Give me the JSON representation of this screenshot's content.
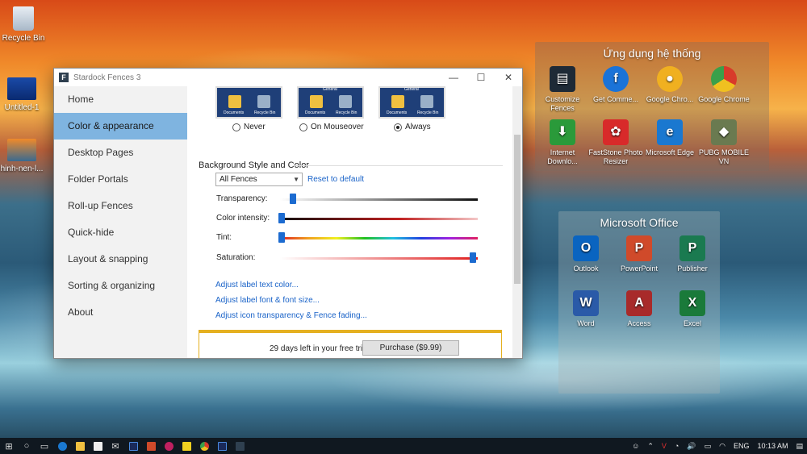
{
  "desktop": {
    "icons": [
      {
        "label": "Recycle Bin"
      },
      {
        "label": "Untitled-1"
      },
      {
        "label": "hinh-nen-l..."
      }
    ]
  },
  "window": {
    "title": "Stardock Fences 3",
    "controls": {
      "minimize": "—",
      "maximize": "☐",
      "close": "✕"
    },
    "sidebar": [
      {
        "label": "Home"
      },
      {
        "label": "Color & appearance",
        "active": true
      },
      {
        "label": "Desktop Pages"
      },
      {
        "label": "Folder Portals"
      },
      {
        "label": "Roll-up Fences"
      },
      {
        "label": "Quick-hide"
      },
      {
        "label": "Layout & snapping"
      },
      {
        "label": "Sorting & organizing"
      },
      {
        "label": "About"
      }
    ],
    "preview_options": [
      {
        "label": "Never",
        "selected": false
      },
      {
        "label": "On Mouseover",
        "selected": false
      },
      {
        "label": "Always",
        "selected": true
      }
    ],
    "preview_captions": {
      "general": "General",
      "documents": "Documents",
      "recycle": "Recycle Bin"
    },
    "background_section": {
      "title": "Background Style and Color",
      "dropdown_value": "All Fences",
      "reset_link": "Reset to default",
      "sliders": [
        {
          "label": "Transparency:",
          "value": 0.06
        },
        {
          "label": "Color intensity:",
          "value": 0.0
        },
        {
          "label": "Tint:",
          "value": 0.0
        },
        {
          "label": "Saturation:",
          "value": 1.0
        }
      ]
    },
    "links": [
      "Adjust label text color...",
      "Adjust label font & font size...",
      "Adjust icon transparency & Fence fading..."
    ],
    "trial": {
      "text": "29 days left in your free trial",
      "button": "Purchase ($9.99)"
    }
  },
  "fence_system": {
    "title": "Ứng dụng hệ thống",
    "items": [
      {
        "label": "Customize Fences",
        "icon": "fences-icon",
        "color": "#1e2a36"
      },
      {
        "label": "Get Comme...",
        "icon": "skype-icon",
        "color": "#1a73d8"
      },
      {
        "label": "Google Chro...",
        "icon": "chrome-canary-icon",
        "color": "#f0b020"
      },
      {
        "label": "Google Chrome",
        "icon": "chrome-icon",
        "color": "#3aa04a"
      },
      {
        "label": "Internet Downlo...",
        "icon": "download-icon",
        "color": "#2a9a3a"
      },
      {
        "label": "FastStone Photo Resizer",
        "icon": "faststone-icon",
        "color": "#d82a2a"
      },
      {
        "label": "Microsoft Edge",
        "icon": "edge-icon",
        "color": "#1a78d0"
      },
      {
        "label": "PUBG MOBILE VN",
        "icon": "pubg-icon",
        "color": "#6a7a50"
      }
    ]
  },
  "fence_office": {
    "title": "Microsoft Office",
    "items": [
      {
        "label": "Outlook",
        "letter": "O",
        "icon": "outlook-icon",
        "color": "#0a64c0"
      },
      {
        "label": "PowerPoint",
        "letter": "P",
        "icon": "powerpoint-icon",
        "color": "#d04a2a"
      },
      {
        "label": "Publisher",
        "letter": "P",
        "icon": "publisher-icon",
        "color": "#1a7a50"
      },
      {
        "label": "Word",
        "letter": "W",
        "icon": "word-icon",
        "color": "#2a5aa8"
      },
      {
        "label": "Access",
        "letter": "A",
        "icon": "access-icon",
        "color": "#a82a2a"
      },
      {
        "label": "Excel",
        "letter": "X",
        "icon": "excel-icon",
        "color": "#1a7a3a"
      }
    ]
  },
  "taskbar": {
    "tray": {
      "language": "ENG",
      "time": "10:13 AM"
    }
  }
}
